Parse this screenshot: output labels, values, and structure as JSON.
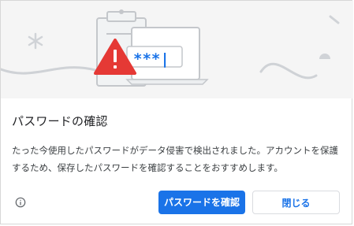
{
  "dialog": {
    "title": "パスワードの確認",
    "body": "たった今使用したパスワードがデータ侵害で検出されました。アカウントを保護するため、保存したパスワードを確認することをおすすめします。",
    "illustration_password": "***|",
    "info_icon": "info-icon",
    "check_button_label": "パスワードを確認",
    "close_button_label": "閉じる"
  },
  "colors": {
    "accent": "#1a73e8",
    "warning": "#e53935",
    "illustration_bg": "#f5f5f5"
  }
}
